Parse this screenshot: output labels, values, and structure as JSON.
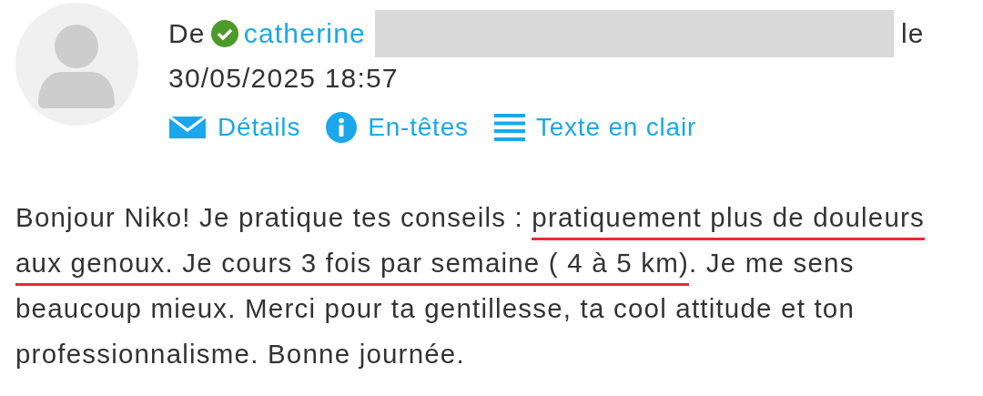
{
  "sender": {
    "prefix": "De",
    "verified": true,
    "name": "catherine",
    "redacted": true,
    "suffix": "le",
    "date": "30/05/2025 18:57"
  },
  "actions": [
    {
      "kind": "details",
      "label": "Détails"
    },
    {
      "kind": "headers",
      "label": "En-têtes"
    },
    {
      "kind": "plain",
      "label": "Texte en clair"
    }
  ],
  "message": [
    {
      "text": "Bonjour Niko! Je pratique tes conseils : ",
      "underlined": false
    },
    {
      "text": "pratiquement plus de douleurs aux genoux. Je cours 3 fois par semaine ( 4 à 5 km)",
      "underlined": true
    },
    {
      "text": ". Je me sens beaucoup mieux. Merci pour ta gentillesse, ta cool attitude et ton professionnalisme. Bonne journée.",
      "underlined": false
    }
  ]
}
